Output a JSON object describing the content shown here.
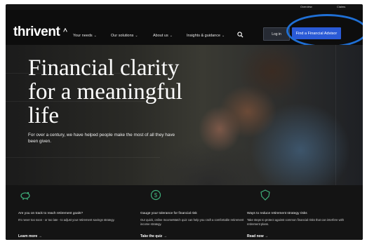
{
  "utility_nav": {
    "link_1": "Overview",
    "link_2": "Claims"
  },
  "brand": {
    "name": "thrivent"
  },
  "nav": {
    "items": [
      {
        "label": "Your needs"
      },
      {
        "label": "Our solutions"
      },
      {
        "label": "About us"
      },
      {
        "label": "Insights & guidance"
      }
    ],
    "login_label": "Log in",
    "cta_label": "Find a Financial Advisor"
  },
  "hero": {
    "headline": "Financial clarity for a meaningful life",
    "subtext": "For over a century, we have helped people make the most of all they have been given."
  },
  "cards": [
    {
      "icon": "piggy-bank-icon",
      "title": "Are you on track to reach retirement goals?",
      "text": "It's never too soon - or too late - to adjust your retirement savings strategy.",
      "link": "Learn more →"
    },
    {
      "icon": "dollar-sign-icon",
      "title": "Gauge your tolerance for financial risk",
      "text": "Our quick, online IncomeMatch quiz can help you craft a comfortable retirement income strategy.",
      "link": "Take the quiz →"
    },
    {
      "icon": "shield-icon",
      "title": "Ways to reduce retirement strategy risks",
      "text": "Take steps to protect against common financial risks that can interfere with retirement plans.",
      "link": "Read now →"
    }
  ],
  "colors": {
    "cta_blue": "#2a5ad6",
    "annotation_circle": "#1f6fd4",
    "icon_green": "#3fae7a"
  }
}
